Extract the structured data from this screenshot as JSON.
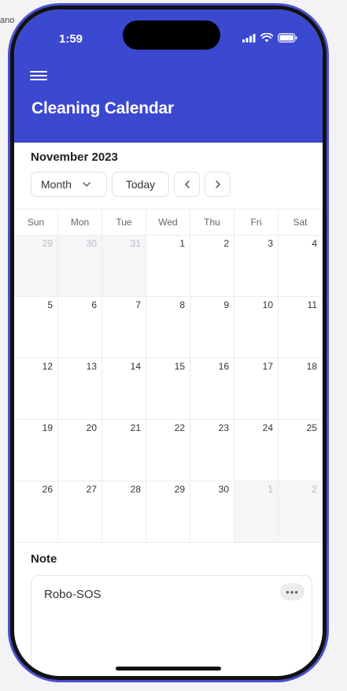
{
  "background_text": "ano",
  "status_bar": {
    "time": "1:59"
  },
  "header": {
    "title": "Cleaning Calendar"
  },
  "calendar": {
    "month_title": "November 2023",
    "view_select": "Month",
    "today_button": "Today",
    "weekdays": [
      "Sun",
      "Mon",
      "Tue",
      "Wed",
      "Thu",
      "Fri",
      "Sat"
    ],
    "weeks": [
      [
        {
          "d": "29",
          "o": true
        },
        {
          "d": "30",
          "o": true
        },
        {
          "d": "31",
          "o": true
        },
        {
          "d": "1",
          "o": false
        },
        {
          "d": "2",
          "o": false
        },
        {
          "d": "3",
          "o": false
        },
        {
          "d": "4",
          "o": false
        }
      ],
      [
        {
          "d": "5",
          "o": false
        },
        {
          "d": "6",
          "o": false
        },
        {
          "d": "7",
          "o": false
        },
        {
          "d": "8",
          "o": false
        },
        {
          "d": "9",
          "o": false
        },
        {
          "d": "10",
          "o": false
        },
        {
          "d": "11",
          "o": false
        }
      ],
      [
        {
          "d": "12",
          "o": false
        },
        {
          "d": "13",
          "o": false
        },
        {
          "d": "14",
          "o": false
        },
        {
          "d": "15",
          "o": false
        },
        {
          "d": "16",
          "o": false
        },
        {
          "d": "17",
          "o": false
        },
        {
          "d": "18",
          "o": false
        }
      ],
      [
        {
          "d": "19",
          "o": false
        },
        {
          "d": "20",
          "o": false
        },
        {
          "d": "21",
          "o": false
        },
        {
          "d": "22",
          "o": false
        },
        {
          "d": "23",
          "o": false
        },
        {
          "d": "24",
          "o": false
        },
        {
          "d": "25",
          "o": false
        }
      ],
      [
        {
          "d": "26",
          "o": false
        },
        {
          "d": "27",
          "o": false
        },
        {
          "d": "28",
          "o": false
        },
        {
          "d": "29",
          "o": false
        },
        {
          "d": "30",
          "o": false
        },
        {
          "d": "1",
          "o": true
        },
        {
          "d": "2",
          "o": true
        }
      ]
    ]
  },
  "note": {
    "label": "Note",
    "text": "Robo-SOS",
    "more": "•••"
  },
  "colors": {
    "header": "#3b48d0",
    "frame": "#4b4fd1",
    "other_month_bg": "#f5f6f7"
  }
}
